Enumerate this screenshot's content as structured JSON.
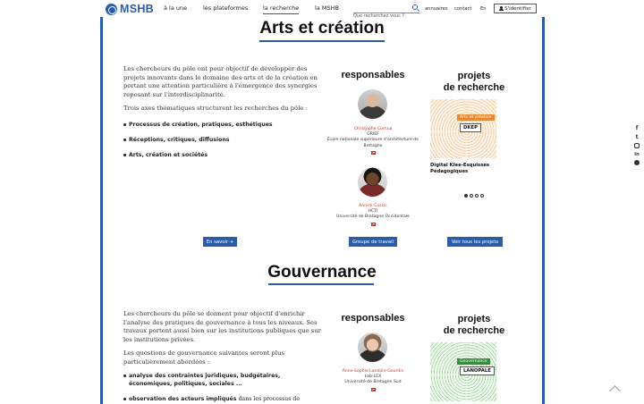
{
  "header": {
    "logo_text": "MSHB",
    "nav": [
      {
        "label": "à la une"
      },
      {
        "label": "les plateformes"
      },
      {
        "label": "la recherche"
      },
      {
        "label": "la MSHB"
      }
    ],
    "search_placeholder": "Que recherchez vous ?",
    "links": {
      "annuaires": "annuaires",
      "contact": "contact",
      "lang": "En"
    },
    "login_label": "S'identifier"
  },
  "sections": [
    {
      "title": "Arts et création",
      "intro": [
        "Les chercheurs du pôle ont pour objectif de développer des projets innovants dans le domaine des arts et de la création en portant une attention particulière à l'émergence des synergies reposant sur l'interdisciplinarité.",
        "Trois axes thématiques structurent les recherches du pôle :"
      ],
      "themes": [
        "Processus de création, pratiques, esthétiques",
        "Réceptions, critiques, diffusions",
        "Arts, création et sociétés"
      ],
      "responsables_heading": "responsables",
      "people": [
        {
          "name": "Christophe Cornua",
          "lab": "GRIEF",
          "institution": "École nationale supérieure d'architecture de Bretagne"
        },
        {
          "name": "Annick Cossic",
          "lab": "HCTI",
          "institution": "Université de Bretagne Occidentale"
        }
      ],
      "projects_heading_1": "projets",
      "projects_heading_2": "de recherche",
      "project": {
        "tag": "Arts et création",
        "acronym": "DKEP",
        "caption": "Digital Klee-Esquisses Pédagogiques"
      },
      "carousel_dots": 4,
      "buttons": {
        "more": "En savoir +",
        "group": "Groupe de travail",
        "all_projects": "Voir tous les projets"
      }
    },
    {
      "title": "Gouvernance",
      "intro": [
        "Les chercheurs du pôle se donnent pour objectif d'enrichir l'analyse des pratiques de gouvernance à tous les niveaux. Ses travaux portent aussi bien sur les institutions publiques que sur les institutions privées.",
        "Les questions de gouvernance suivantes seront plus particulièrement abordées :"
      ],
      "themes": [
        "analyse des contraintes juridiques, budgétaires, économiques, politiques, sociales ...",
        "observation des acteurs impliqués"
      ],
      "theme2_suffix": "dans les processus de",
      "responsables_heading": "responsables",
      "people": [
        {
          "name": "Anne-Sophie Lamblin-Gourdin",
          "lab": "Lab-LEX",
          "institution": "Université de Bretagne Sud"
        }
      ],
      "projects_heading_1": "projets",
      "projects_heading_2": "de recherche",
      "project": {
        "tag": "Gouvernance",
        "acronym": "LANOPALE"
      }
    }
  ],
  "social_icons": [
    "facebook-icon",
    "twitter-icon",
    "instagram-icon",
    "linkedin-icon",
    "vimeo-icon"
  ],
  "colors": {
    "brand_blue": "#2a5ca8",
    "name_red": "#c0392b",
    "tag_orange": "#e28a33",
    "tag_green": "#2f8f3a"
  }
}
